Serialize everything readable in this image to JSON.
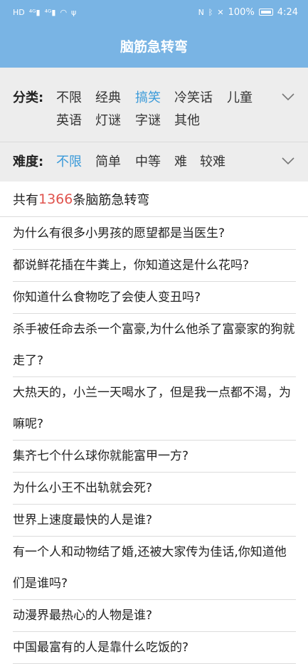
{
  "status_bar": {
    "left_icons": [
      "HD",
      "4G",
      "4G",
      "wifi",
      "usb"
    ],
    "battery": "100%",
    "time": "4:24"
  },
  "header": {
    "title": "脑筋急转弯"
  },
  "filters": {
    "category_label": "分类:",
    "categories": [
      "不限",
      "经典",
      "搞笑",
      "冷笑话",
      "儿童",
      "英语",
      "灯谜",
      "字谜",
      "其他"
    ],
    "category_selected": "搞笑",
    "difficulty_label": "难度:",
    "difficulties": [
      "不限",
      "简单",
      "中等",
      "难",
      "较难"
    ],
    "difficulty_selected": "不限"
  },
  "summary": {
    "prefix": "共有",
    "count": "1366",
    "suffix": "条脑筋急转弯"
  },
  "questions": [
    "为什么有很多小男孩的愿望都是当医生?",
    "都说鲜花插在牛粪上，你知道这是什么花吗?",
    "你知道什么食物吃了会使人变丑吗?",
    "杀手被任命去杀一个富豪,为什么他杀了富豪家的狗就走了?",
    "大热天的，小兰一天喝水了，但是我一点都不渴，为嘛呢?",
    "集齐七个什么球你就能富甲一方?",
    "为什么小王不出轨就会死?",
    "世界上速度最快的人是谁?",
    "有一个人和动物结了婚,还被大家传为佳话,你知道他们是谁吗?",
    "动漫界最热心的人物是谁?",
    "中国最富有的人是靠什么吃饭的?"
  ],
  "colors": {
    "header_bg": "#79b4e4",
    "accent": "#3a9ad9",
    "count": "#e0534d",
    "filter_bg": "#ededed"
  }
}
